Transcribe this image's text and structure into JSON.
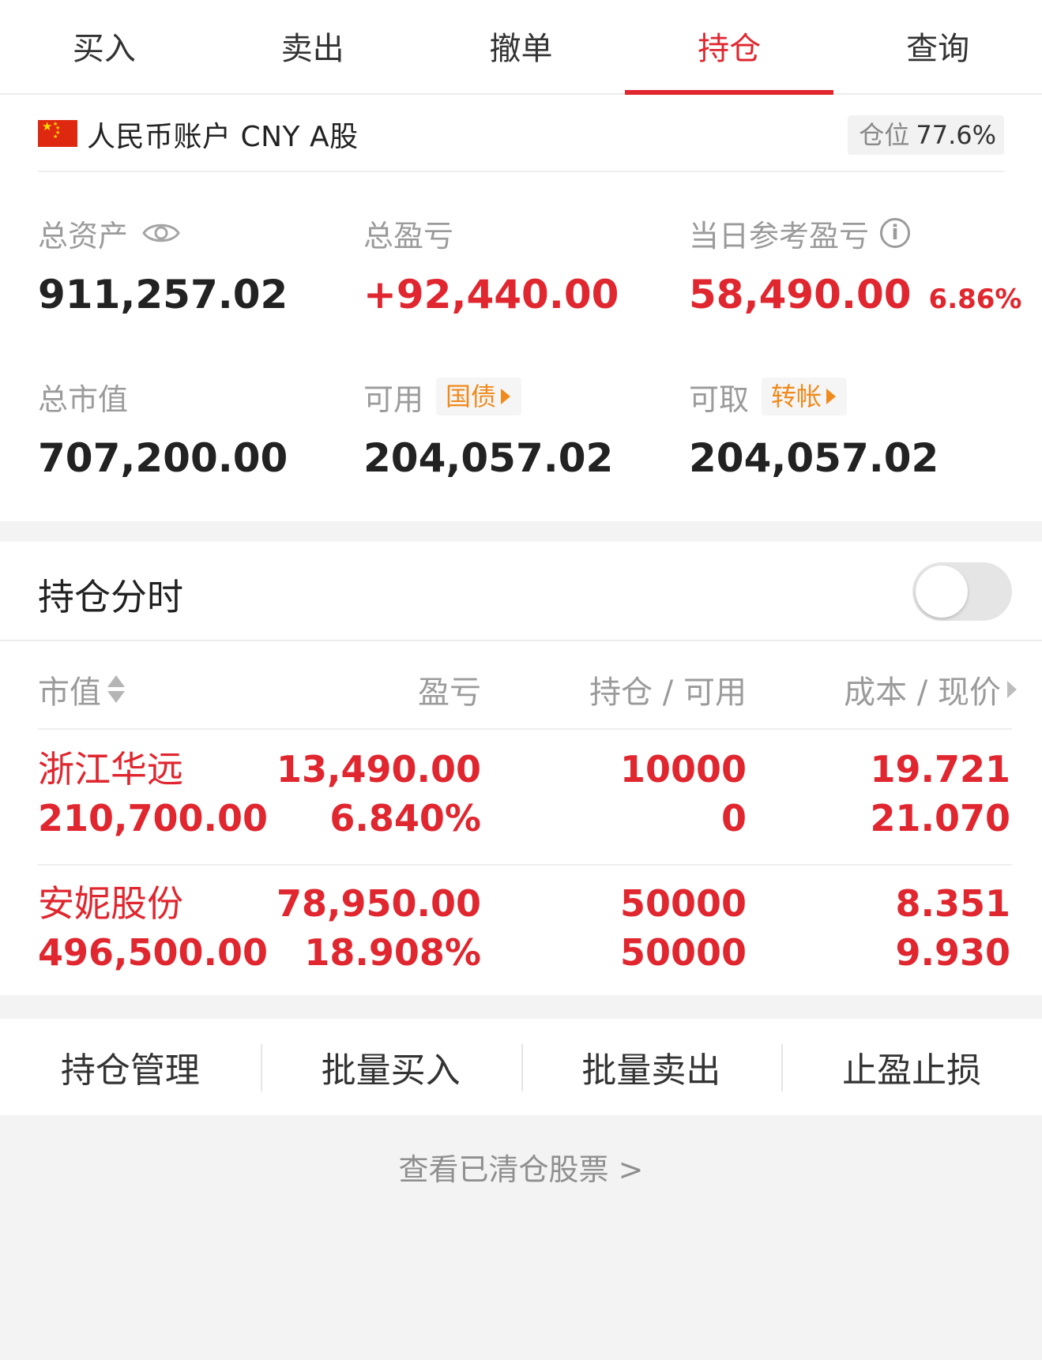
{
  "tabs": [
    {
      "label": "买入"
    },
    {
      "label": "卖出"
    },
    {
      "label": "撤单"
    },
    {
      "label": "持仓",
      "active": true
    },
    {
      "label": "查询"
    }
  ],
  "account": {
    "name": "人民币账户 CNY A股",
    "position_label": "仓位",
    "position_value": "77.6%"
  },
  "summary": {
    "total_assets": {
      "label": "总资产",
      "value": "911,257.02"
    },
    "total_pnl": {
      "label": "总盈亏",
      "value": "+92,440.00"
    },
    "daily_pnl": {
      "label": "当日参考盈亏",
      "value": "58,490.00",
      "pct": "6.86%"
    },
    "market_value": {
      "label": "总市值",
      "value": "707,200.00"
    },
    "available": {
      "label": "可用",
      "chip": "国债",
      "value": "204,057.02"
    },
    "withdrawable": {
      "label": "可取",
      "chip": "转帐",
      "value": "204,057.02"
    }
  },
  "holdings": {
    "title": "持仓分时",
    "toggle_on": false,
    "columns": [
      "市值",
      "盈亏",
      "持仓 / 可用",
      "成本 / 现价"
    ],
    "rows": [
      {
        "name": "浙江华远",
        "market_value": "210,700.00",
        "pnl": "13,490.00",
        "pnl_pct": "6.840%",
        "position": "10000",
        "available": "0",
        "cost": "19.721",
        "price": "21.070"
      },
      {
        "name": "安妮股份",
        "market_value": "496,500.00",
        "pnl": "78,950.00",
        "pnl_pct": "18.908%",
        "position": "50000",
        "available": "50000",
        "cost": "8.351",
        "price": "9.930"
      }
    ]
  },
  "actions": [
    {
      "label": "持仓管理"
    },
    {
      "label": "批量买入"
    },
    {
      "label": "批量卖出"
    },
    {
      "label": "止盈止损"
    }
  ],
  "cleared_link": "查看已清仓股票 >",
  "colors": {
    "accent_red": "#e0262f",
    "orange": "#f08a1c",
    "gray_text": "#9b9b9b",
    "background": "#f3f3f3"
  }
}
